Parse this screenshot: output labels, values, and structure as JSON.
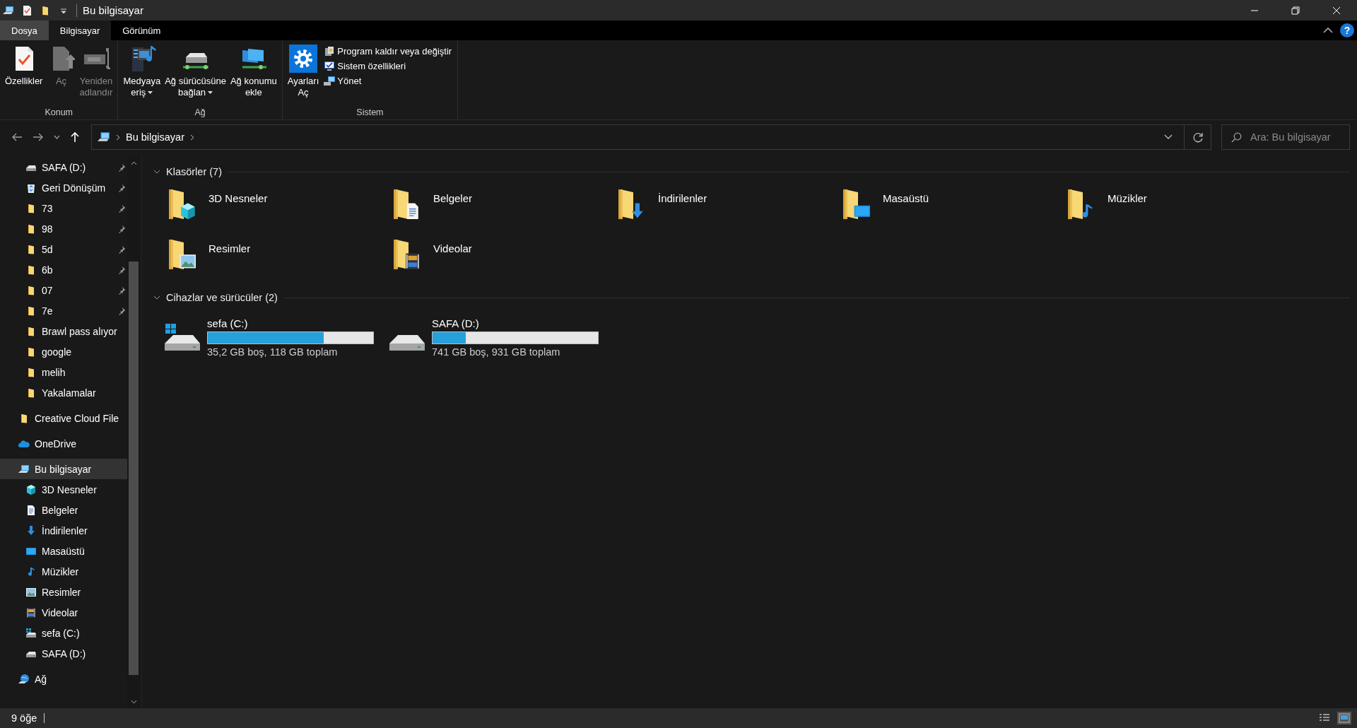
{
  "window": {
    "title": "Bu bilgisayar",
    "quick_access_toolbar": [
      {
        "kind": "pc"
      },
      {
        "kind": "properties"
      },
      {
        "kind": "folder"
      },
      {
        "kind": "dropdown"
      }
    ]
  },
  "tabs": [
    {
      "label": "Dosya",
      "kind": "file",
      "selected": false
    },
    {
      "label": "Bilgisayar",
      "kind": "tab",
      "selected": true
    },
    {
      "label": "Görünüm",
      "kind": "tab",
      "selected": false
    }
  ],
  "help_button": {
    "label": "?"
  },
  "ribbon": {
    "groups": [
      {
        "label": "Konum",
        "buttons": [
          {
            "lines": [
              "Özellikler"
            ],
            "kind": "properties",
            "disabled": false,
            "dropdown": false
          },
          {
            "lines": [
              "Aç"
            ],
            "kind": "open",
            "disabled": true,
            "dropdown": false
          },
          {
            "lines": [
              "Yeniden",
              "adlandır"
            ],
            "kind": "rename",
            "disabled": true,
            "dropdown": false
          }
        ]
      },
      {
        "label": "Ağ",
        "buttons": [
          {
            "lines": [
              "Medyaya",
              "eriş"
            ],
            "kind": "media",
            "disabled": false,
            "dropdown": true
          },
          {
            "lines": [
              "Ağ sürücüsüne",
              "bağlan"
            ],
            "kind": "mapdrive",
            "disabled": false,
            "dropdown": true
          },
          {
            "lines": [
              "Ağ konumu",
              "ekle"
            ],
            "kind": "netloc",
            "disabled": false,
            "dropdown": false
          }
        ]
      },
      {
        "label": "Sistem",
        "buttons": [
          {
            "lines": [
              "Ayarları",
              "Aç"
            ],
            "kind": "settings",
            "disabled": false,
            "dropdown": false
          }
        ],
        "small_buttons": [
          {
            "label": "Program kaldır veya değiştir",
            "kind": "program"
          },
          {
            "label": "Sistem özellikleri",
            "kind": "sysprops"
          },
          {
            "label": "Yönet",
            "kind": "manage"
          }
        ]
      }
    ]
  },
  "address_bar": {
    "path": [
      "Bu bilgisayar"
    ]
  },
  "search": {
    "placeholder": "Ara: Bu bilgisayar"
  },
  "sidebar": {
    "quick_access": [
      {
        "label": "SAFA (D:)",
        "kind": "drive",
        "pinned": true
      },
      {
        "label": "Geri Dönüşüm",
        "kind": "recycle",
        "pinned": true
      },
      {
        "label": "73",
        "kind": "folder",
        "pinned": true
      },
      {
        "label": "98",
        "kind": "folder",
        "pinned": true
      },
      {
        "label": "5d",
        "kind": "folder",
        "pinned": true
      },
      {
        "label": "6b",
        "kind": "folder",
        "pinned": true
      },
      {
        "label": "07",
        "kind": "folder",
        "pinned": true
      },
      {
        "label": "7e",
        "kind": "folder",
        "pinned": true
      },
      {
        "label": "Brawl pass alıyor",
        "kind": "folder",
        "pinned": false
      },
      {
        "label": "google",
        "kind": "folder",
        "pinned": false
      },
      {
        "label": "melih",
        "kind": "folder",
        "pinned": false
      },
      {
        "label": "Yakalamalar",
        "kind": "folder",
        "pinned": false
      }
    ],
    "items": [
      {
        "label": "Creative Cloud File",
        "kind": "folder",
        "selected": false
      },
      {
        "label": "OneDrive",
        "kind": "cloud",
        "selected": false
      },
      {
        "label": "Bu bilgisayar",
        "kind": "pc",
        "selected": true,
        "children": [
          {
            "label": "3D Nesneler",
            "kind": "cube",
            "selected": false
          },
          {
            "label": "Belgeler",
            "kind": "doc",
            "selected": false
          },
          {
            "label": "İndirilenler",
            "kind": "download",
            "selected": false
          },
          {
            "label": "Masaüstü",
            "kind": "desktop",
            "selected": false
          },
          {
            "label": "Müzikler",
            "kind": "music",
            "selected": false
          },
          {
            "label": "Resimler",
            "kind": "picture",
            "selected": false
          },
          {
            "label": "Videolar",
            "kind": "film",
            "selected": false
          },
          {
            "label": "sefa (C:)",
            "kind": "windrive",
            "selected": false
          },
          {
            "label": "SAFA (D:)",
            "kind": "drive",
            "selected": false
          }
        ]
      },
      {
        "label": "Ağ",
        "kind": "network",
        "selected": false
      }
    ]
  },
  "sections": [
    {
      "title": "Klasörler (7)",
      "kind": "folders",
      "expanded": true,
      "items": [
        {
          "name": "3D Nesneler",
          "kind": "cube"
        },
        {
          "name": "Belgeler",
          "kind": "doc"
        },
        {
          "name": "İndirilenler",
          "kind": "download"
        },
        {
          "name": "Masaüstü",
          "kind": "desktop"
        },
        {
          "name": "Müzikler",
          "kind": "music"
        },
        {
          "name": "Resimler",
          "kind": "picture"
        },
        {
          "name": "Videolar",
          "kind": "film"
        }
      ]
    },
    {
      "title": "Cihazlar ve sürücüler (2)",
      "kind": "drives",
      "expanded": true,
      "items": [
        {
          "name": "sefa (C:)",
          "kind": "system",
          "level": 0.7,
          "info": "35,2 GB boş, 118 GB toplam"
        },
        {
          "name": "SAFA (D:)",
          "kind": "data",
          "level": 0.2,
          "info": "741 GB boş, 931 GB toplam"
        }
      ]
    }
  ],
  "status_bar": {
    "count": "9 öğe",
    "views": [
      {
        "kind": "details",
        "selected": false
      },
      {
        "kind": "large",
        "selected": true
      }
    ]
  }
}
